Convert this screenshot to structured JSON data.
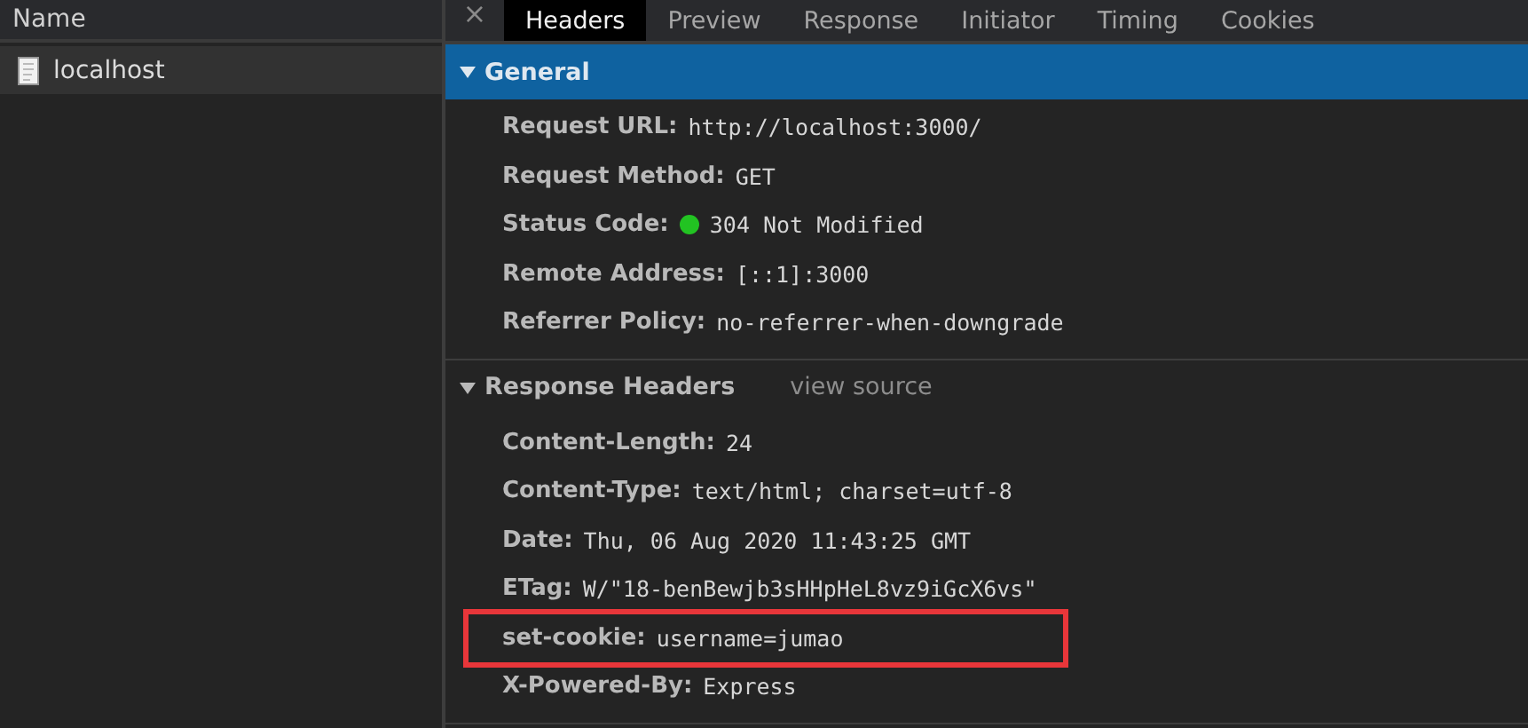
{
  "request_list": {
    "column": "Name",
    "items": [
      {
        "name": "localhost",
        "selected": true
      }
    ]
  },
  "close_symbol": "×",
  "tabs": [
    {
      "label": "Headers",
      "selected": true
    },
    {
      "label": "Preview",
      "selected": false
    },
    {
      "label": "Response",
      "selected": false
    },
    {
      "label": "Initiator",
      "selected": false
    },
    {
      "label": "Timing",
      "selected": false
    },
    {
      "label": "Cookies",
      "selected": false
    }
  ],
  "sections": [
    {
      "title": "General",
      "expanded": true,
      "rows": [
        {
          "key": "Request URL:",
          "value": "http://localhost:3000/",
          "highlighted": false
        },
        {
          "key": "Request Method:",
          "value": "GET",
          "highlighted": false
        },
        {
          "key": "Status Code:",
          "value": "304 Not Modified",
          "color": "#22c322",
          "highlighted": false
        },
        {
          "key": "Remote Address:",
          "value": "[::1]:3000",
          "highlighted": false
        },
        {
          "key": "Referrer Policy:",
          "value": "no-referrer-when-downgrade",
          "highlighted": false
        }
      ]
    },
    {
      "title": "Response Headers",
      "expanded": true,
      "link": "view source",
      "rows": [
        {
          "key": "Content-Length:",
          "value": "24",
          "highlighted": false
        },
        {
          "key": "Content-Type:",
          "value": "text/html; charset=utf-8",
          "highlighted": false
        },
        {
          "key": "Date:",
          "value": "Thu, 06 Aug 2020 11:43:25 GMT",
          "highlighted": false
        },
        {
          "key": "ETag:",
          "value": "W/\"18-benBewjb3sHHpHeL8vz9iGcX6vs\"",
          "highlighted": false
        },
        {
          "key": "set-cookie:",
          "value": "username=jumao",
          "highlighted": true
        },
        {
          "key": "X-Powered-By:",
          "value": "Express",
          "highlighted": false
        }
      ]
    }
  ]
}
